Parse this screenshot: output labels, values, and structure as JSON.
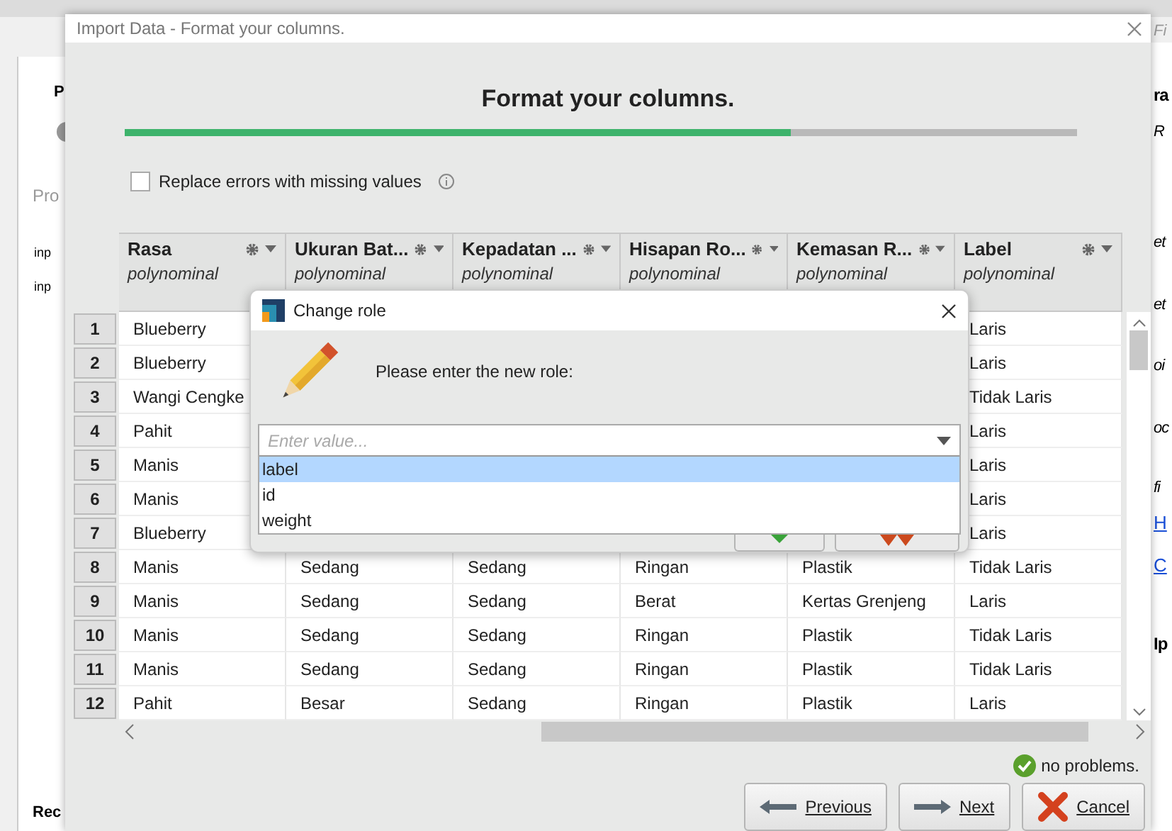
{
  "background": {
    "left_texts": [
      {
        "text": "P",
        "kind": "tab"
      },
      {
        "text": "Pro",
        "kind": "label"
      },
      {
        "text": "inp",
        "kind": "port"
      },
      {
        "text": "inp",
        "kind": "port"
      },
      {
        "text": "Rec",
        "kind": "tab"
      }
    ],
    "right_texts": [
      {
        "text": "Fi",
        "kind": "search"
      },
      {
        "text": "ra",
        "kind": "heading"
      },
      {
        "text": "R",
        "kind": "label"
      },
      {
        "text": "et",
        "kind": "label"
      },
      {
        "text": "et",
        "kind": "label"
      },
      {
        "text": "oi",
        "kind": "label"
      },
      {
        "text": "oc",
        "kind": "label"
      },
      {
        "text": "fi",
        "kind": "label"
      },
      {
        "text": "H",
        "kind": "link"
      },
      {
        "text": "C",
        "kind": "link"
      },
      {
        "text": "Ip",
        "kind": "heading"
      }
    ]
  },
  "window": {
    "title": "Import Data - Format your columns.",
    "heading": "Format your columns.",
    "progress": {
      "level": 0.7
    },
    "replace_errors": {
      "label": "Replace errors with missing values",
      "checked": false
    },
    "table": {
      "columns": [
        {
          "name": "Rasa",
          "type": "polynominal"
        },
        {
          "name": "Ukuran Bat...",
          "type": "polynominal"
        },
        {
          "name": "Kepadatan ...",
          "type": "polynominal"
        },
        {
          "name": "Hisapan Ro...",
          "type": "polynominal"
        },
        {
          "name": "Kemasan R...",
          "type": "polynominal"
        },
        {
          "name": "Label",
          "type": "polynominal"
        }
      ],
      "rows": [
        {
          "number": "1",
          "cells": [
            "Blueberry",
            null,
            null,
            null,
            null,
            "Laris"
          ]
        },
        {
          "number": "2",
          "cells": [
            "Blueberry",
            null,
            null,
            null,
            null,
            "Laris"
          ]
        },
        {
          "number": "3",
          "cells": [
            "Wangi Cengke",
            null,
            null,
            null,
            null,
            "Tidak Laris"
          ]
        },
        {
          "number": "4",
          "cells": [
            "Pahit",
            null,
            null,
            null,
            null,
            "Laris"
          ]
        },
        {
          "number": "5",
          "cells": [
            "Manis",
            null,
            null,
            null,
            null,
            "Laris"
          ]
        },
        {
          "number": "6",
          "cells": [
            "Manis",
            null,
            null,
            null,
            null,
            "Laris"
          ]
        },
        {
          "number": "7",
          "cells": [
            "Blueberry",
            null,
            null,
            null,
            null,
            "Laris"
          ]
        },
        {
          "number": "8",
          "cells": [
            "Manis",
            "Sedang",
            "Sedang",
            "Ringan",
            "Plastik",
            "Tidak Laris"
          ]
        },
        {
          "number": "9",
          "cells": [
            "Manis",
            "Sedang",
            "Sedang",
            "Berat",
            "Kertas Grenjeng",
            "Laris"
          ]
        },
        {
          "number": "10",
          "cells": [
            "Manis",
            "Sedang",
            "Sedang",
            "Ringan",
            "Plastik",
            "Tidak Laris"
          ]
        },
        {
          "number": "11",
          "cells": [
            "Manis",
            "Sedang",
            "Sedang",
            "Ringan",
            "Plastik",
            "Tidak Laris"
          ]
        },
        {
          "number": "12",
          "cells": [
            "Pahit",
            "Besar",
            "Sedang",
            "Ringan",
            "Plastik",
            "Laris"
          ]
        }
      ]
    },
    "status": "no problems.",
    "buttons": [
      {
        "label": "Previous",
        "kind": "previous"
      },
      {
        "label": "Next",
        "kind": "next"
      },
      {
        "label": "Cancel",
        "kind": "cancel"
      }
    ]
  },
  "change_role": {
    "title": "Change role",
    "prompt": "Please enter the new role:",
    "placeholder": "Enter value...",
    "options": [
      {
        "label": "label",
        "selected": true
      },
      {
        "label": "id",
        "selected": false
      },
      {
        "label": "weight",
        "selected": false
      }
    ],
    "buttons": [
      {
        "kind": "ok"
      },
      {
        "kind": "cancel"
      }
    ]
  }
}
